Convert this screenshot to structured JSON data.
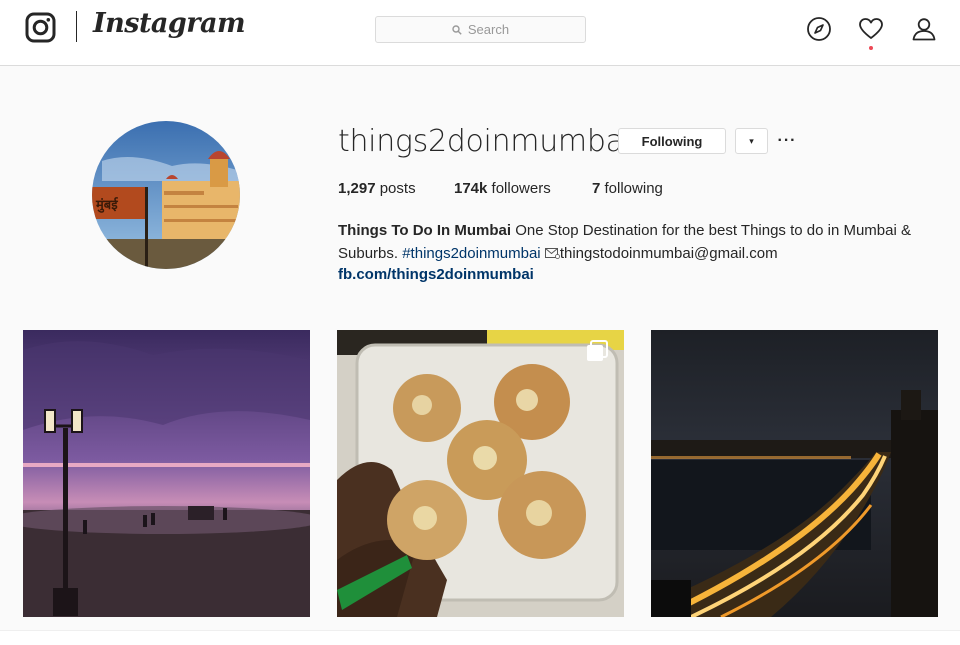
{
  "header": {
    "logo_text": "Instagram",
    "search": {
      "placeholder": "Search"
    },
    "icons": [
      "camera-logo-icon",
      "compass-icon",
      "heart-icon",
      "person-icon"
    ],
    "notification_dot_color": "#ed4956"
  },
  "profile": {
    "username": "things2doinmumbai",
    "following_button": "Following",
    "dropdown_button": "▾",
    "more_button": "···",
    "avatar_sign_text": "मुंबई",
    "stats": {
      "posts_count": "1,297",
      "posts_label": " posts",
      "followers_count": "174k",
      "followers_label": " followers",
      "following_count": "7",
      "following_label": " following"
    },
    "bio": {
      "name": "Things To Do In Mumbai",
      "text1": " One Stop Destination for the best Things to do in Mumbai & Suburbs. ",
      "hashtag": "#things2doinmumbai",
      "email": "thingstodoinmumbai@gmail.com"
    },
    "website": "fb.com/things2doinmumbai"
  },
  "posts": [
    {
      "name": "beach-sunset-post"
    },
    {
      "name": "pani-puri-post",
      "badge": "multiple-images-icon"
    },
    {
      "name": "marine-drive-night-post"
    }
  ],
  "colors": {
    "link": "#003569",
    "border": "#dbdbdb",
    "background": "#fafafa"
  }
}
